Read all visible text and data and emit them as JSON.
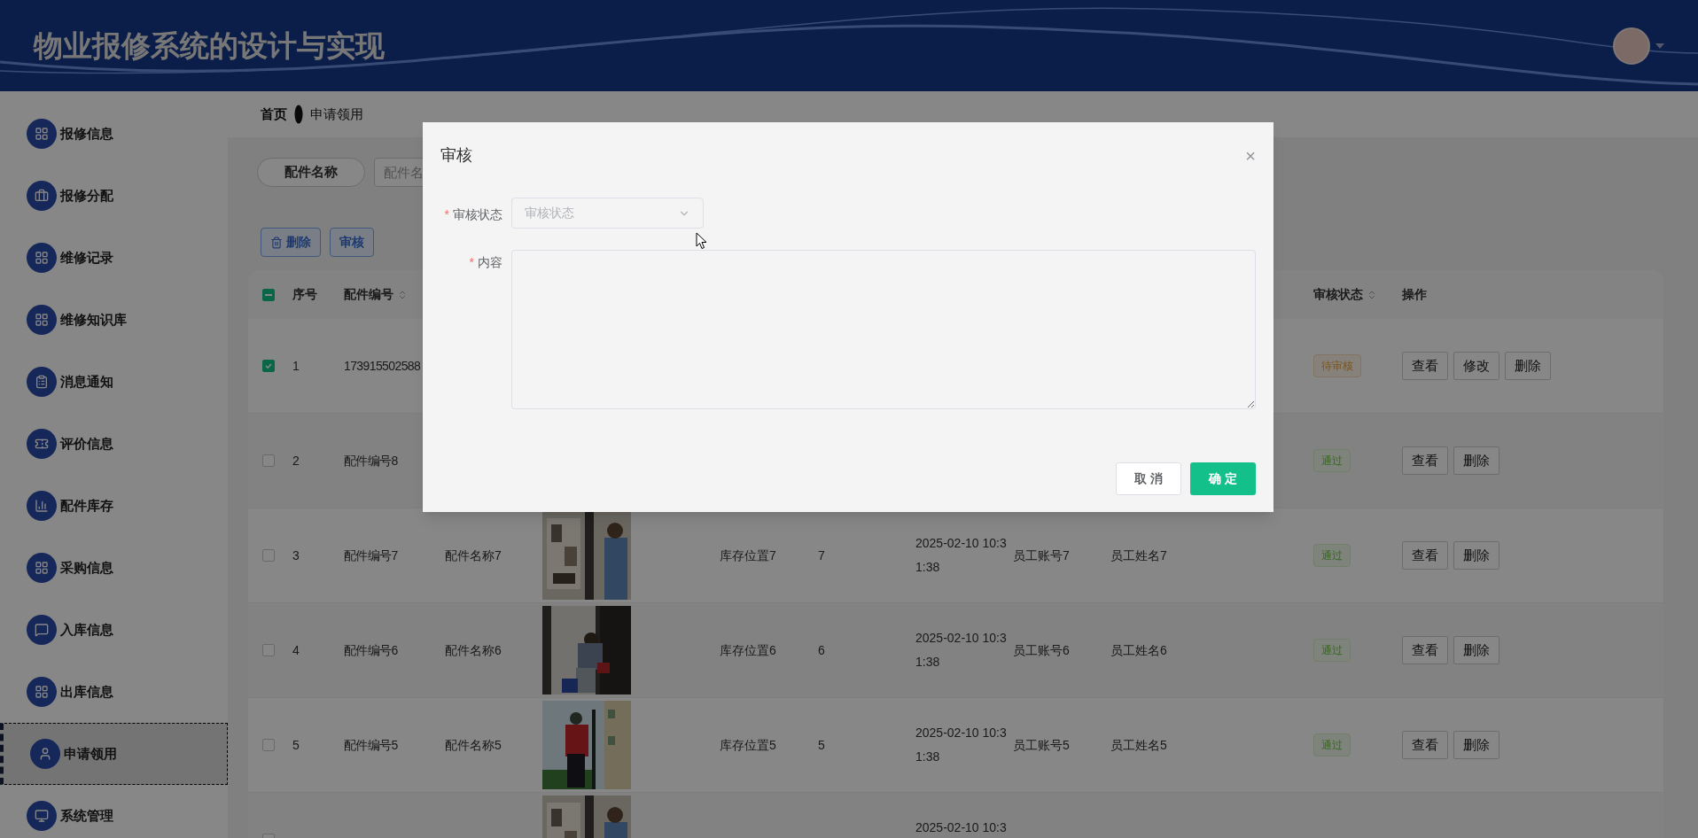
{
  "header": {
    "title": "物业报修系统的设计与实现"
  },
  "breadcrumb": [
    "首页",
    "申请领用"
  ],
  "sidebar": {
    "items": [
      {
        "label": "报修信息",
        "selected": false
      },
      {
        "label": "报修分配",
        "selected": false
      },
      {
        "label": "维修记录",
        "selected": false
      },
      {
        "label": "维修知识库",
        "selected": false
      },
      {
        "label": "消息通知",
        "selected": false
      },
      {
        "label": "评价信息",
        "selected": false
      },
      {
        "label": "配件库存",
        "selected": false
      },
      {
        "label": "采购信息",
        "selected": false
      },
      {
        "label": "入库信息",
        "selected": false
      },
      {
        "label": "出库信息",
        "selected": false
      },
      {
        "label": "申请领用",
        "selected": true
      },
      {
        "label": "系统管理",
        "selected": false
      }
    ]
  },
  "search": {
    "label": "配件名称",
    "placeholder": "配件名"
  },
  "toolbar": {
    "buttons": [
      {
        "label": "删除",
        "kind": "delete"
      },
      {
        "label": "审核",
        "kind": "audit"
      }
    ]
  },
  "table": {
    "select_all": {
      "indeterminate": true
    },
    "columns": [
      {
        "label": "序号",
        "sortable": false
      },
      {
        "label": "配件编号",
        "sortable": true
      },
      {
        "label": "审核状态",
        "sortable": true
      },
      {
        "label": "操作",
        "sortable": false
      }
    ],
    "rows": [
      {
        "selected": true,
        "seq": "1",
        "part_no": "173915502588",
        "status": {
          "label": "待审核",
          "kind": "pending"
        },
        "actions": [
          "查看",
          "修改",
          "删除"
        ]
      },
      {
        "selected": false,
        "seq": "2",
        "part_no": "配件编号8",
        "status": {
          "label": "通过",
          "kind": "passed"
        },
        "actions": [
          "查看",
          "删除"
        ]
      },
      {
        "selected": false,
        "seq": "3",
        "part_no": "配件编号7",
        "part_name": "配件名称7",
        "image": {
          "kind": "picture"
        },
        "location": "库存位置7",
        "qty": "7",
        "time": "2025-02-10 10:31:38",
        "account": "员工账号7",
        "name": "员工姓名7",
        "status": {
          "label": "通过",
          "kind": "passed"
        },
        "actions": [
          "查看",
          "删除"
        ]
      },
      {
        "selected": false,
        "seq": "4",
        "part_no": "配件编号6",
        "part_name": "配件名称6",
        "image": {
          "kind": "picture"
        },
        "location": "库存位置6",
        "qty": "6",
        "time": "2025-02-10 10:31:38",
        "account": "员工账号6",
        "name": "员工姓名6",
        "status": {
          "label": "通过",
          "kind": "passed"
        },
        "actions": [
          "查看",
          "删除"
        ]
      },
      {
        "selected": false,
        "seq": "5",
        "part_no": "配件编号5",
        "part_name": "配件名称5",
        "image": {
          "kind": "picture"
        },
        "location": "库存位置5",
        "qty": "5",
        "time": "2025-02-10 10:31:38",
        "account": "员工账号5",
        "name": "员工姓名5",
        "status": {
          "label": "通过",
          "kind": "passed"
        },
        "actions": [
          "查看",
          "删除"
        ]
      },
      {
        "selected": false,
        "image": {
          "kind": "picture"
        },
        "time": "2025-02-10 10:3"
      }
    ]
  },
  "dialog": {
    "title": "审核",
    "close": "×",
    "fields": [
      {
        "kind": "select",
        "label": "审核状态",
        "required_mark": "*",
        "placeholder": "审核状态"
      },
      {
        "kind": "textarea",
        "label": "内容",
        "required_mark": "*"
      }
    ],
    "buttons": [
      {
        "label": "取 消",
        "kind": "cancel"
      },
      {
        "label": "确 定",
        "kind": "primary"
      }
    ]
  }
}
